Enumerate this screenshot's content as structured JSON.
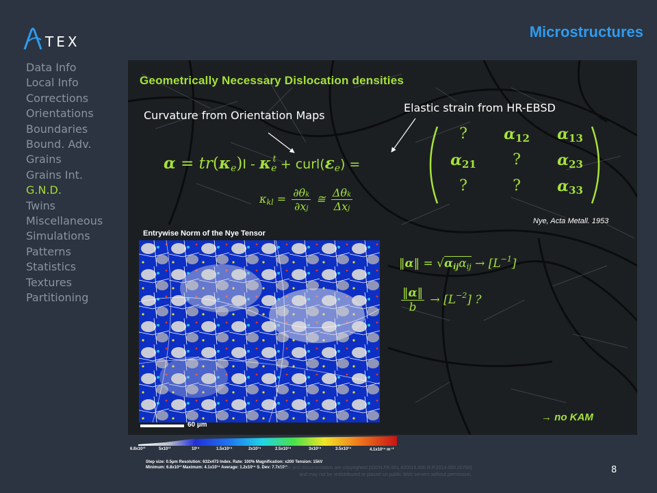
{
  "header": {
    "logo_text": "TEX",
    "title": "Microstructures"
  },
  "sidebar": {
    "active_color": "#a8d838",
    "items": [
      {
        "label": "Data Info"
      },
      {
        "label": "Local Info"
      },
      {
        "label": "Corrections"
      },
      {
        "label": "Orientations"
      },
      {
        "label": "Boundaries"
      },
      {
        "label": "Bound. Adv."
      },
      {
        "label": "Grains"
      },
      {
        "label": "Grains Int."
      },
      {
        "label": "G.N.D.",
        "active": true
      },
      {
        "label": "Twins"
      },
      {
        "label": "Miscellaneous"
      },
      {
        "label": "Simulations"
      },
      {
        "label": "Patterns"
      },
      {
        "label": "Statistics"
      },
      {
        "label": "Textures"
      },
      {
        "label": "Partitioning"
      }
    ]
  },
  "slide": {
    "heading": "Geometrically  Necessary  Dislocation  densities",
    "curvature_label": "Curvature from Orientation Maps",
    "strain_label": "Elastic strain from HR-EBSD",
    "eq": {
      "minus": "I - ",
      "plus": " + curl(",
      "close": ") ="
    },
    "matrix": [
      "?",
      "α12",
      "α13",
      "α21",
      "?",
      "α23",
      "?",
      "?",
      "α33"
    ],
    "reference": "Nye, Acta Metall. 1953",
    "map_title": "Entrywise Norm of the Nye Tensor",
    "scale_label": "60 µm",
    "note": "→ no KAM",
    "colorbar_ticks": [
      "6.8x10¹³",
      "5x10¹³",
      "10¹⁴",
      "1.5x10¹⁴",
      "2x10¹⁴",
      "2.5x10¹⁴",
      "3x10¹⁴",
      "3.5x10¹⁴",
      "4.1x10¹⁴  m⁻²"
    ],
    "stats_line1": "Step size: 0.5µm    Resolution: 632x473    Index. Rate: 100%    Magnification: x200    Tension: 15kV",
    "stats_line2": "Minimum: 6.8x10¹³    Maximum: 4.1x10¹⁴    Average: 1.2x10¹⁴    S. Dev: 7.7x10¹³",
    "copyright_line1": "code and documentation are copyrighted (IDDN.FR.001.420015.000.R.P.2014.000.20700)",
    "copyright_line2": "and may not be redistributed or placed on public Web servers without permission.",
    "page_number": "8"
  }
}
